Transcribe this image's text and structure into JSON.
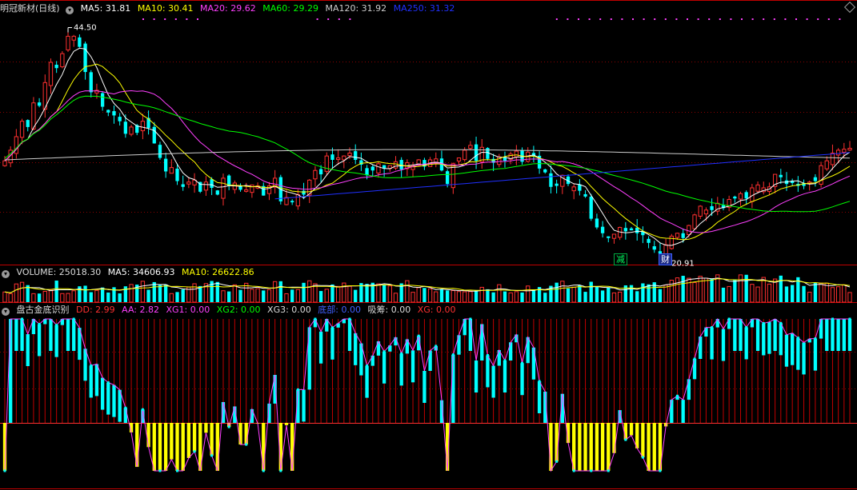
{
  "main_panel": {
    "title": "明冠新材(日线)",
    "legend": [
      {
        "label": "MA5: 31.81",
        "color": "#ffffff"
      },
      {
        "label": "MA10: 30.41",
        "color": "#ffff00"
      },
      {
        "label": "MA20: 29.62",
        "color": "#ff40ff"
      },
      {
        "label": "MA60: 29.29",
        "color": "#00ff00"
      },
      {
        "label": "MA120: 31.92",
        "color": "#cccccc"
      },
      {
        "label": "MA250: 31.32",
        "color": "#2030ff"
      }
    ],
    "high_label": "44.50",
    "low_label": "20.91",
    "event_tags": [
      "减",
      "财"
    ]
  },
  "volume_panel": {
    "legend": [
      {
        "label": "VOLUME: 25018.30",
        "color": "#dcdcdc"
      },
      {
        "label": "MA5: 34606.93",
        "color": "#ffffff"
      },
      {
        "label": "MA10: 26622.86",
        "color": "#ffff00"
      }
    ]
  },
  "indicator_panel": {
    "title": "盘古金底识别",
    "legend": [
      {
        "label": "DD: 2.99",
        "color": "#ff3030"
      },
      {
        "label": "AA: 2.82",
        "color": "#ff40ff"
      },
      {
        "label": "XG1: 0.00",
        "color": "#ff40ff"
      },
      {
        "label": "XG2: 0.00",
        "color": "#00ff00"
      },
      {
        "label": "XG3: 0.00",
        "color": "#dcdcdc"
      },
      {
        "label": "底部: 0.00",
        "color": "#4060ff"
      },
      {
        "label": "吸筹: 0.00",
        "color": "#dcdcdc"
      },
      {
        "label": "XG: 0.00",
        "color": "#ff3030"
      }
    ]
  },
  "colors": {
    "up": "#ff3030",
    "down": "#00ffff",
    "ma5": "#ffffff",
    "ma10": "#ffff00",
    "ma20": "#ff40ff",
    "ma60": "#00ff00",
    "ma120": "#cccccc",
    "ma250": "#2030ff",
    "grid": "#8b0000",
    "bottom_fill": "#ffff00"
  },
  "chart_data": {
    "type": "candlestick",
    "closes": [
      30.5,
      31.6,
      33.0,
      34.6,
      34.0,
      36.5,
      36.2,
      38.6,
      40.7,
      40.1,
      41.6,
      43.4,
      43.4,
      42.3,
      39.7,
      37.6,
      37.8,
      36.1,
      35.5,
      35.2,
      34.6,
      33.3,
      34.0,
      33.4,
      34.6,
      33.9,
      32.3,
      30.8,
      29.4,
      29.8,
      28.4,
      27.8,
      28.3,
      28.5,
      27.3,
      28.3,
      27.7,
      27.0,
      28.7,
      27.9,
      28.2,
      27.5,
      27.5,
      28.0,
      27.9,
      26.9,
      27.9,
      28.7,
      26.3,
      26.7,
      26.2,
      27.0,
      27.0,
      28.5,
      29.5,
      29.1,
      31.0,
      30.6,
      30.8,
      31.0,
      31.3,
      30.6,
      30.1,
      29.0,
      29.5,
      30.2,
      29.7,
      30.0,
      30.4,
      29.6,
      30.3,
      30.0,
      30.6,
      29.9,
      30.6,
      30.7,
      29.5,
      28.1,
      30.2,
      30.8,
      31.6,
      32.1,
      30.5,
      31.9,
      30.7,
      30.3,
      30.9,
      30.5,
      31.2,
      31.5,
      30.4,
      31.4,
      31.0,
      29.7,
      29.3,
      27.8,
      27.9,
      29.0,
      28.1,
      27.8,
      27.4,
      26.8,
      24.5,
      23.6,
      23.0,
      22.5,
      22.9,
      23.6,
      23.2,
      23.3,
      23.0,
      22.8,
      22.0,
      21.3,
      20.9,
      21.8,
      22.7,
      23.0,
      22.5,
      23.8,
      24.9,
      25.8,
      25.4,
      25.4,
      26.1,
      25.6,
      26.5,
      26.6,
      27.1,
      26.6,
      27.7,
      28.0,
      27.7,
      27.8,
      29.1,
      28.8,
      28.1,
      28.2,
      27.9,
      27.9,
      28.3,
      28.4,
      30.0,
      30.5,
      31.3,
      31.6,
      31.7,
      31.8
    ],
    "price_ylim": [
      20.0,
      45.5
    ],
    "volume_ma5": 34606.93,
    "volume_ma10": 26622.86,
    "volume_last": 25018.3,
    "ma_last": {
      "MA5": 31.81,
      "MA10": 30.41,
      "MA20": 29.62,
      "MA60": 29.29,
      "MA120": 31.92,
      "MA250": 31.32
    },
    "indicator_baseline": 0
  }
}
